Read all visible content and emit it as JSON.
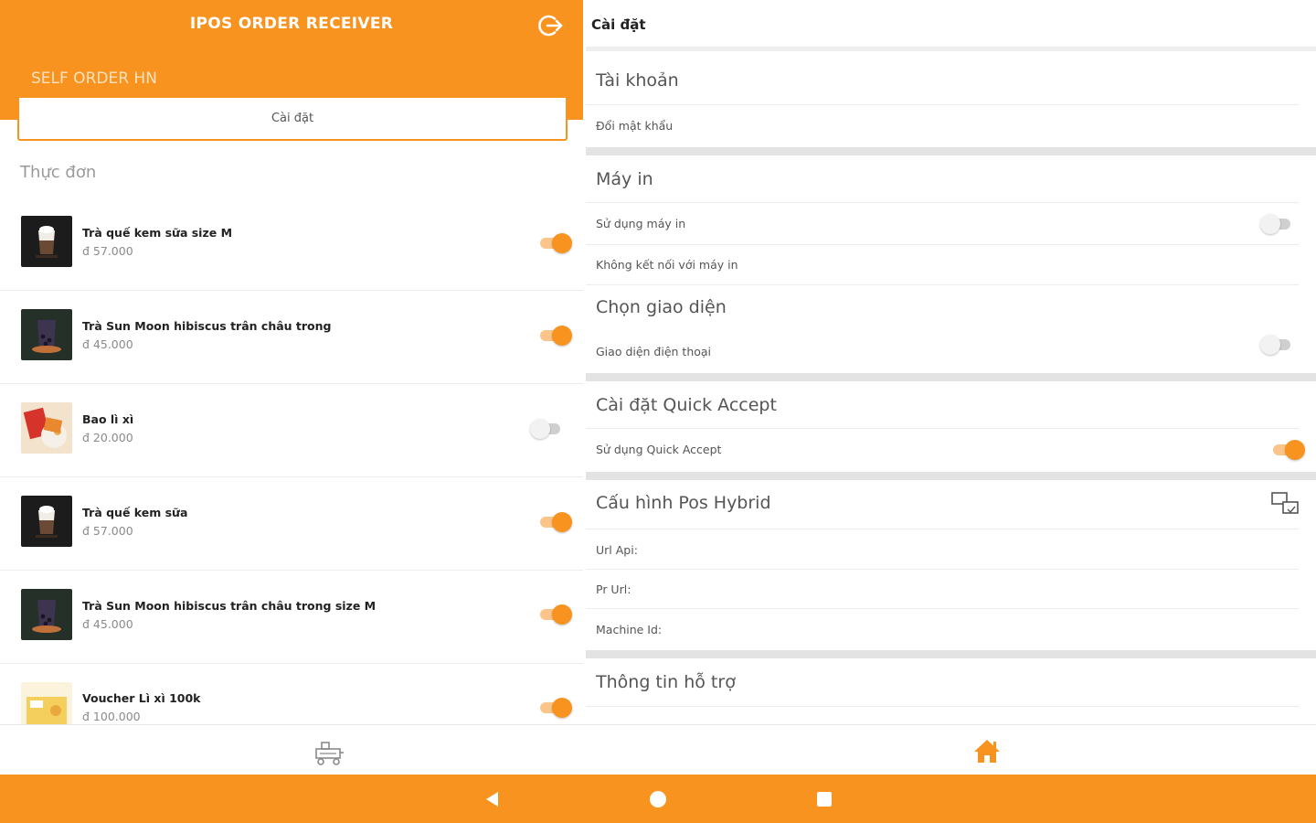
{
  "app": {
    "title": "IPOS ORDER RECEIVER",
    "store_name": "SELF ORDER HN",
    "settings_tab_label": "Cài đặt",
    "menu_section_label": "Thực đơn"
  },
  "menu_items": [
    {
      "name": "Trà quế kem sữa size M",
      "price": "đ 57.000",
      "enabled": true,
      "thumb": "cream-tea"
    },
    {
      "name": "Trà Sun Moon hibiscus trân châu trong",
      "price": "đ 45.000",
      "enabled": true,
      "thumb": "hibiscus-tea"
    },
    {
      "name": "Bao lì xì",
      "price": "đ 20.000",
      "enabled": false,
      "thumb": "red-envelope"
    },
    {
      "name": "Trà quế kem sữa",
      "price": "đ 57.000",
      "enabled": true,
      "thumb": "cream-tea"
    },
    {
      "name": "Trà Sun Moon hibiscus trân châu trong size M",
      "price": "đ 45.000",
      "enabled": true,
      "thumb": "hibiscus-tea"
    },
    {
      "name": "Voucher Lì xì 100k",
      "price": "đ 100.000",
      "enabled": true,
      "thumb": "voucher"
    }
  ],
  "settings": {
    "title": "Cài đặt",
    "account": {
      "title": "Tài khoản",
      "change_password": "Đổi mật khẩu"
    },
    "printer": {
      "title": "Máy in",
      "use_printer": "Sử dụng máy in",
      "use_printer_enabled": false,
      "status": "Không kết nối với máy in"
    },
    "ui": {
      "title": "Chọn giao diện",
      "phone_ui": "Giao diện điện thoại",
      "phone_ui_enabled": false
    },
    "quick_accept": {
      "title": "Cài đặt Quick Accept",
      "use_quick_accept": "Sử dụng Quick Accept",
      "enabled": true
    },
    "pos_hybrid": {
      "title": "Cấu hình Pos Hybrid",
      "url_api": "Url Api:",
      "pr_url": "Pr Url:",
      "machine_id": "Machine Id:"
    },
    "support": {
      "title": "Thông tin hỗ trợ"
    }
  },
  "colors": {
    "brand": "#f7931e",
    "toggle_on_track": "#fbc58a",
    "toggle_off_track": "#cfcfcf"
  },
  "icons": {
    "logout": "logout-icon",
    "copy": "copy-icon",
    "orders": "orders-icon",
    "home": "home-icon",
    "back": "back-icon",
    "android_home": "android-home-icon",
    "recents": "recents-icon"
  }
}
